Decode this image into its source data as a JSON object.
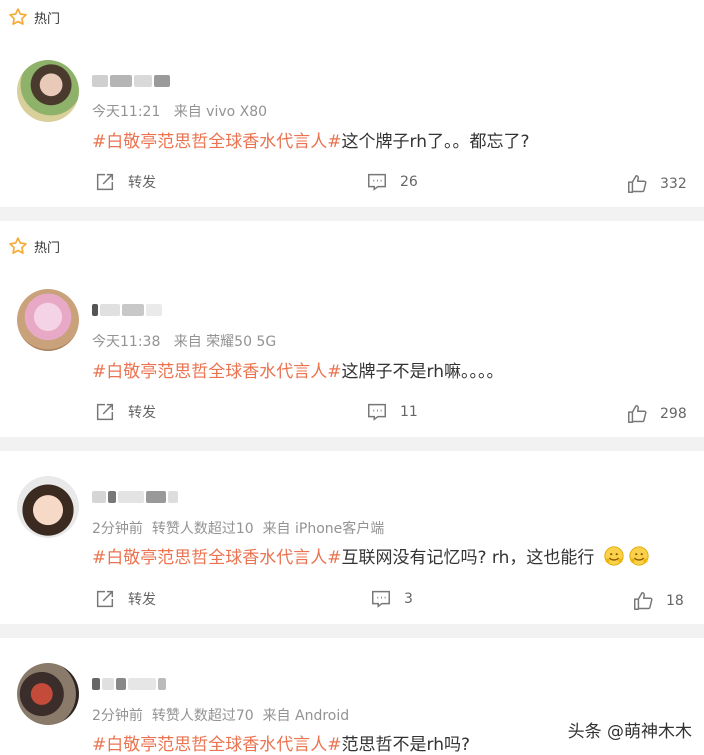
{
  "hot_label": "热门",
  "comments": [
    {
      "time": "今天11:21",
      "source": "来自 vivo X80",
      "hashtag": "#白敬亭范思哲全球香水代言人#",
      "text": "这个牌子rh了。。都忘了?",
      "repost": "转发",
      "comments": "26",
      "likes": "332"
    },
    {
      "time": "今天11:38",
      "source": "来自 荣耀50 5G",
      "hashtag": "#白敬亭范思哲全球香水代言人#",
      "text": "这牌子不是rh嘛。。。。",
      "repost": "转发",
      "comments": "11",
      "likes": "298"
    },
    {
      "time": "2分钟前",
      "extra": "转赞人数超过10",
      "source": "来自 iPhone客户端",
      "hashtag": "#白敬亭范思哲全球香水代言人#",
      "text": "互联网没有记忆吗? rh，这也能行",
      "repost": "转发",
      "comments": "3",
      "likes": "18"
    },
    {
      "time": "2分钟前",
      "extra": "转赞人数超过70",
      "source": "来自 Android",
      "hashtag": "#白敬亭范思哲全球香水代言人#",
      "text": "范思哲不是rh吗?"
    }
  ],
  "watermark": "头条 @萌神木木",
  "colors": {
    "tag": "#eb7350",
    "meta": "#939393",
    "separator": "#f2f2f2",
    "star": "#f7a935"
  }
}
